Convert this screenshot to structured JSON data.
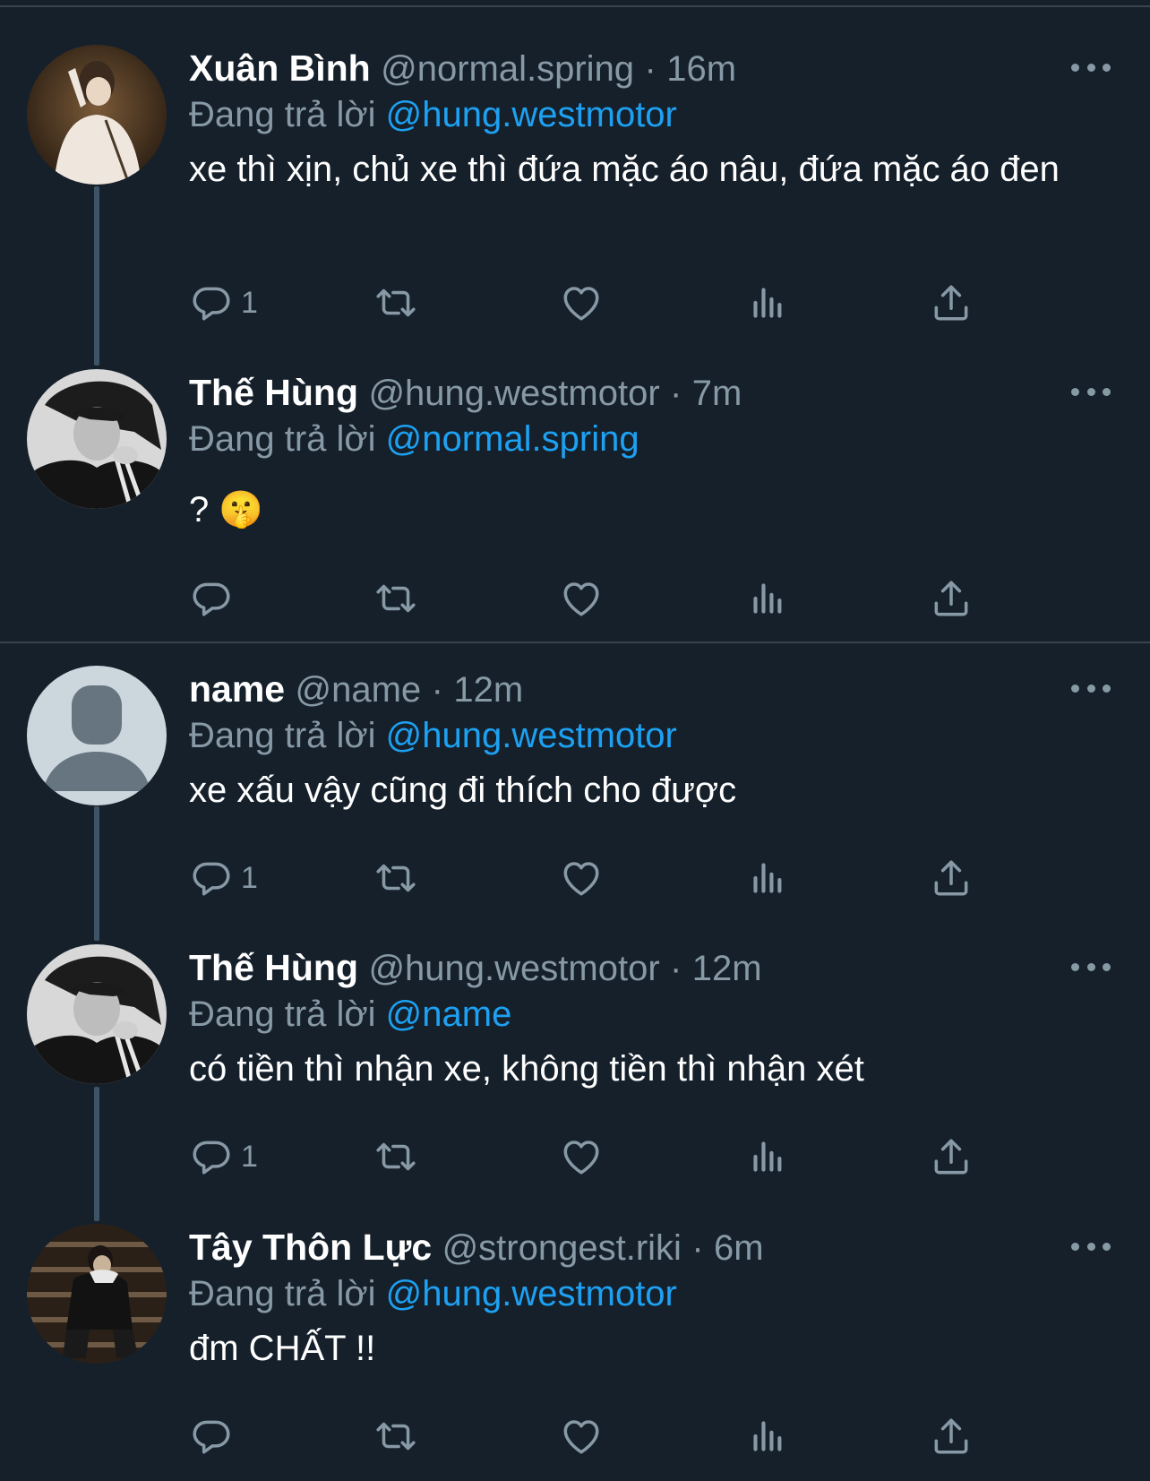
{
  "colors": {
    "background": "#15202b",
    "text": "#ffffff",
    "muted": "#8899a6",
    "mention": "#1da1f2",
    "divider": "#38444d"
  },
  "icons": {
    "reply": "reply-icon",
    "retweet": "retweet-icon",
    "like": "heart-icon",
    "views": "analytics-icon",
    "share": "share-icon",
    "more": "more-icon"
  },
  "tweets": [
    {
      "name": "Xuân Bình",
      "handle": "@normal.spring",
      "separator": "·",
      "time": "16m",
      "replying_label": "Đang trả lời",
      "replying_to": "@hung.westmotor",
      "text": "xe thì xịn, chủ xe thì đứa mặc áo nâu, đứa mặc áo đen",
      "reply_count": "1"
    },
    {
      "name": "Thế Hùng",
      "handle": "@hung.westmotor",
      "separator": "·",
      "time": "7m",
      "replying_label": "Đang trả lời",
      "replying_to": "@normal.spring",
      "text": "? 🤫",
      "reply_count": ""
    },
    {
      "name": "name",
      "handle": "@name",
      "separator": "·",
      "time": "12m",
      "replying_label": "Đang trả lời",
      "replying_to": "@hung.westmotor",
      "text": "xe xấu vậy cũng đi thích cho được",
      "reply_count": "1"
    },
    {
      "name": "Thế Hùng",
      "handle": "@hung.westmotor",
      "separator": "·",
      "time": "12m",
      "replying_label": "Đang trả lời",
      "replying_to": "@name",
      "text": "có tiền thì nhận xe, không tiền thì nhận xét",
      "reply_count": "1"
    },
    {
      "name": "Tây Thôn Lực",
      "handle": "@strongest.riki",
      "separator": "·",
      "time": "6m",
      "replying_label": "Đang trả lời",
      "replying_to": "@hung.westmotor",
      "text": "đm CHẤT !!",
      "reply_count": ""
    }
  ]
}
